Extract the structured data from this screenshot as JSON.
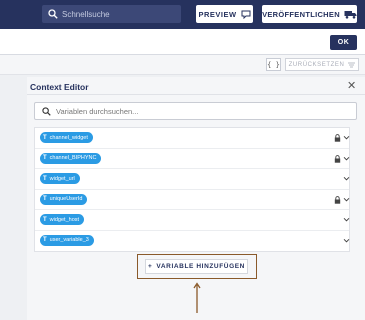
{
  "topbar": {
    "search_placeholder": "Schnellsuche",
    "preview_label": "PREVIEW",
    "publish_label": "VERÖFFENTLICHEN"
  },
  "band": {
    "ok_label": "OK"
  },
  "toolbar": {
    "braces_label": "{ }",
    "reset_label": "ZURÜCKSETZEN"
  },
  "panel": {
    "title": "Context Editor",
    "close_glyph": "✕",
    "search_placeholder": "Variablen durchsuchen...",
    "chip_type": "T",
    "variables": [
      {
        "name": "channel_widget",
        "locked": true
      },
      {
        "name": "channel_BIPHYNC",
        "locked": true
      },
      {
        "name": "widget_url",
        "locked": false
      },
      {
        "name": "uniqueUserId",
        "locked": true
      },
      {
        "name": "widget_host",
        "locked": false
      },
      {
        "name": "user_variable_3",
        "locked": false
      }
    ],
    "add_label": "VARIABLE HINZUFÜGEN",
    "add_glyph": "+"
  },
  "colors": {
    "navy": "#26325e",
    "chip_blue": "#2b9be4",
    "highlight_frame": "#8a5a2b"
  }
}
